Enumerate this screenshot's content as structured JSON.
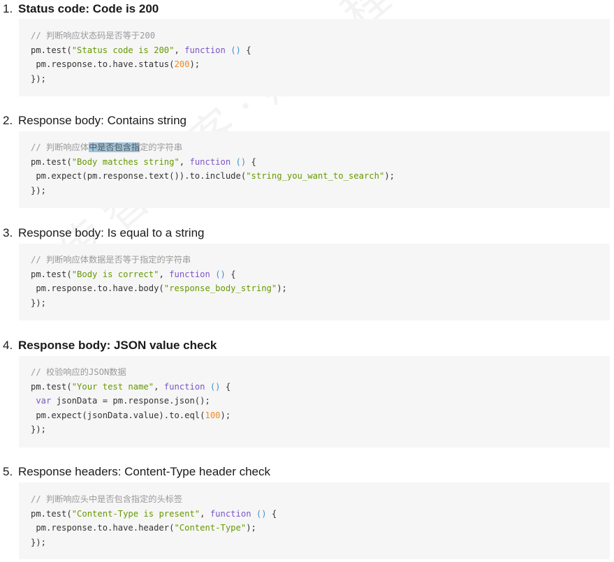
{
  "watermark": "传智播客·黑马程序员",
  "sections": [
    {
      "number": "1.",
      "title": "Status code: Code is 200",
      "code": {
        "comment": "// 判断响应状态码是否等于200",
        "test_prefix": "pm.test(",
        "test_name": "\"Status code is 200\"",
        "test_sep": ", ",
        "fn_kw": "function",
        "fn_parens": "()",
        "fn_open": " {",
        "body_prefix": " pm.response.to.have.status(",
        "body_num": "200",
        "body_suffix": ");",
        "close": "});"
      }
    },
    {
      "number": "2.",
      "title": "Response body: Contains string",
      "code": {
        "comment_pre": "// 判断响应体",
        "comment_hl": "中是否包含指",
        "comment_post": "定的字符串",
        "test_prefix": "pm.test(",
        "test_name": "\"Body matches string\"",
        "test_sep": ", ",
        "fn_kw": "function",
        "fn_parens": "()",
        "fn_open": " {",
        "body_prefix": " pm.expect(pm.response.text()).to.include(",
        "body_str": "\"string_you_want_to_search\"",
        "body_suffix": ");",
        "close": "});"
      }
    },
    {
      "number": "3.",
      "title": "Response body: Is equal to a string",
      "code": {
        "comment": "// 判断响应体数据是否等于指定的字符串",
        "test_prefix": "pm.test(",
        "test_name": "\"Body is correct\"",
        "test_sep": ", ",
        "fn_kw": "function",
        "fn_parens": "()",
        "fn_open": " {",
        "body_prefix": " pm.response.to.have.body(",
        "body_str": "\"response_body_string\"",
        "body_suffix": ");",
        "close": "});"
      }
    },
    {
      "number": "4.",
      "title": "Response body: JSON value check",
      "code": {
        "comment": "// 校验响应的JSON数据",
        "test_prefix": "pm.test(",
        "test_name": "\"Your test name\"",
        "test_sep": ", ",
        "fn_kw": "function",
        "fn_parens": "()",
        "fn_open": " {",
        "var_kw": " var",
        "var_rest": " jsonData = pm.response.json();",
        "body_prefix": " pm.expect(jsonData.value).to.eql(",
        "body_num": "100",
        "body_suffix": ");",
        "close": "});"
      }
    },
    {
      "number": "5.",
      "title": "Response headers: Content-Type header check",
      "code": {
        "comment": "// 判断响应头中是否包含指定的头标签",
        "test_prefix": "pm.test(",
        "test_name": "\"Content-Type is present\"",
        "test_sep": ", ",
        "fn_kw": "function",
        "fn_parens": "()",
        "fn_open": " {",
        "body_prefix": " pm.response.to.have.header(",
        "body_str": "\"Content-Type\"",
        "body_suffix": ");",
        "close": "});"
      }
    }
  ]
}
